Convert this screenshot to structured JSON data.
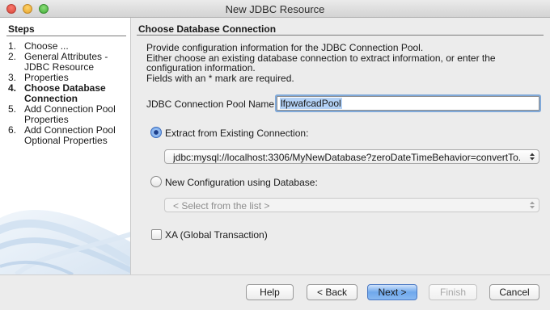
{
  "window": {
    "title": "New JDBC Resource"
  },
  "steps": {
    "heading": "Steps",
    "items": [
      {
        "num": "1.",
        "label": "Choose ...",
        "current": false
      },
      {
        "num": "2.",
        "label": "General Attributes -\nJDBC Resource",
        "current": false
      },
      {
        "num": "3.",
        "label": "Properties",
        "current": false
      },
      {
        "num": "4.",
        "label": "Choose Database\nConnection",
        "current": true
      },
      {
        "num": "5.",
        "label": "Add Connection Pool\nProperties",
        "current": false
      },
      {
        "num": "6.",
        "label": "Add Connection Pool\nOptional Properties",
        "current": false
      }
    ]
  },
  "main": {
    "section_title": "Choose Database Connection",
    "description": [
      "Provide configuration information for the JDBC Connection Pool.",
      "Either choose an existing database connection to extract information, or enter the",
      "configuration information.",
      "Fields with an * mark are required."
    ],
    "pool_name_label": "JDBC Connection Pool Name:*",
    "pool_name_value": "lfpwafcadPool",
    "extract_label": "Extract from Existing Connection:",
    "extract_selected": true,
    "connection_value": "jdbc:mysql://localhost:3306/MyNewDatabase?zeroDateTimeBehavior=convertTo...",
    "new_config_label": "New Configuration using Database:",
    "new_config_selected": false,
    "database_placeholder": "< Select from the list >",
    "xa_label": "XA (Global Transaction)",
    "xa_checked": false
  },
  "buttons": {
    "help": "Help",
    "back": "< Back",
    "next": "Next >",
    "finish": "Finish",
    "cancel": "Cancel"
  },
  "colors": {
    "accent": "#6fa8ec",
    "selection": "#b3d1f5",
    "focus_ring": "#80a9d9"
  }
}
